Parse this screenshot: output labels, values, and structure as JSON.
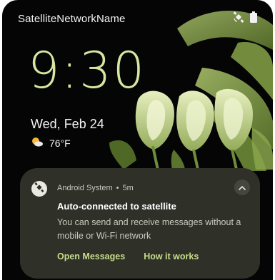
{
  "status_bar": {
    "carrier": "SatelliteNetworkName",
    "icons": [
      "satellite-icon",
      "battery-icon"
    ]
  },
  "lockscreen": {
    "time": "9:30",
    "date": "Wed, Feb 24",
    "weather": {
      "icon": "partly-sunny-icon",
      "temperature": "76°F"
    }
  },
  "notification": {
    "app_icon": "satellite-icon",
    "app_name": "Android System",
    "separator": "•",
    "age": "5m",
    "title": "Auto-connected to satellite",
    "body": "You can send and receive messages without a mobile or Wi-Fi network",
    "actions": [
      {
        "label": "Open Messages"
      },
      {
        "label": "How it works"
      }
    ]
  },
  "colors": {
    "clock": "#d6e8a0",
    "notification_bg": "#2f3129",
    "action_accent": "#c6dc8a",
    "background": "#050505"
  }
}
